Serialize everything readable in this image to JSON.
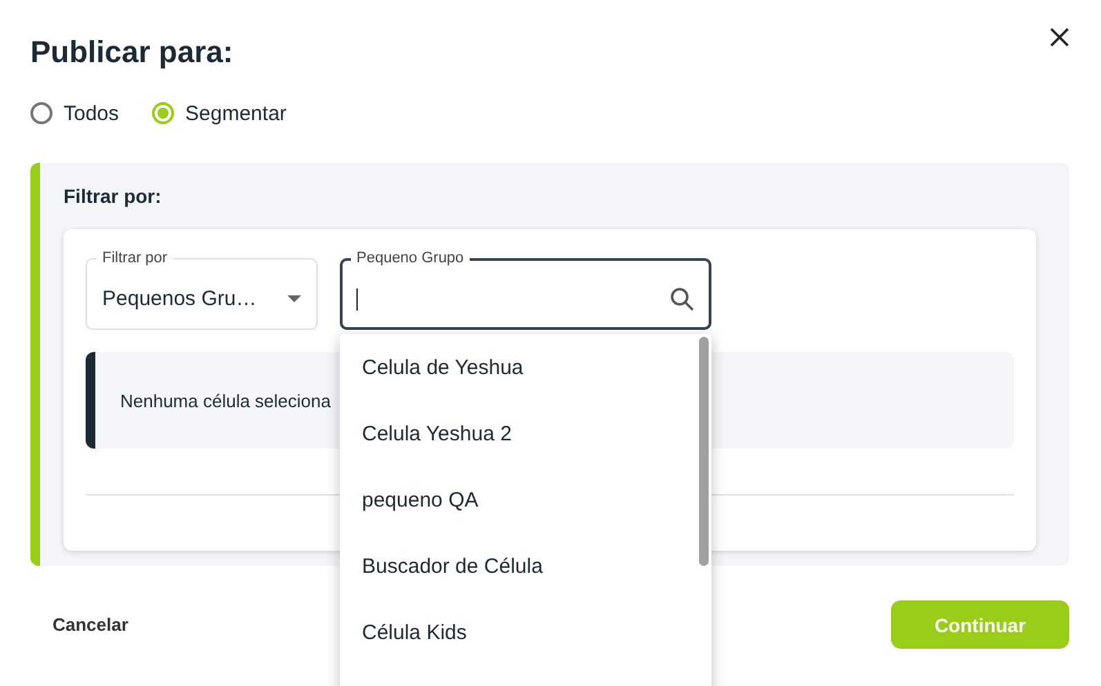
{
  "dialog": {
    "title": "Publicar para:"
  },
  "audience": [
    {
      "label": "Todos",
      "selected": false
    },
    {
      "label": "Segmentar",
      "selected": true
    }
  ],
  "filter_panel": {
    "title": "Filtrar por:",
    "filter_select": {
      "label": "Filtrar por",
      "value": "Pequenos Gru…"
    },
    "search_field": {
      "label": "Pequeno Grupo"
    },
    "info": "Nenhuma célula seleciona"
  },
  "dropdown": {
    "items": [
      {
        "label": "Celula de Yeshua"
      },
      {
        "label": "Celula Yeshua 2"
      },
      {
        "label": "pequeno QA"
      },
      {
        "label": "Buscador de Célula"
      },
      {
        "label": "Célula Kids"
      }
    ]
  },
  "buttons": {
    "cancel": "Cancelar",
    "continue": "Continuar"
  }
}
